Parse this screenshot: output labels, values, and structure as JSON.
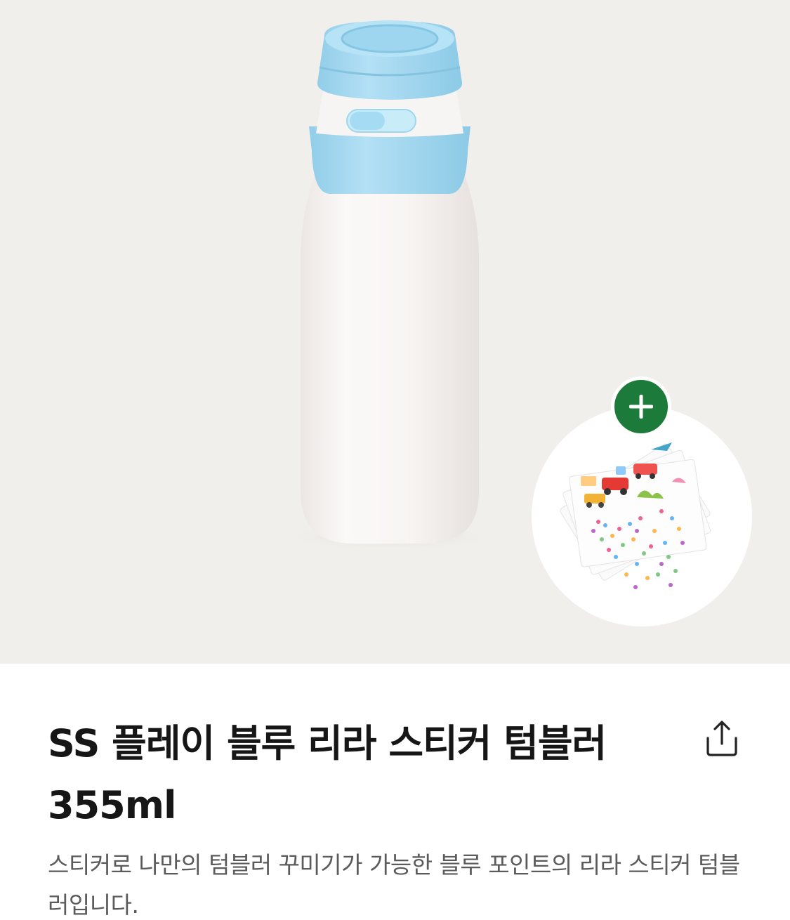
{
  "product": {
    "title": "SS 플레이 블루 리라 스티커 텀블러 355ml",
    "description": "스티커로 나만의 텀블러 꾸미기가 가능한 블루 포인트의 리라 스티커 텀블러입니다."
  },
  "icons": {
    "add": "plus-icon",
    "share": "share-icon"
  },
  "colors": {
    "hero_background": "#f1efec",
    "accent_green": "#1c7a3b",
    "bottle_body": "#f7f4f2",
    "bottle_blue": "#a9dbf2",
    "title_text": "#161616",
    "description_text": "#5b5b5b"
  }
}
